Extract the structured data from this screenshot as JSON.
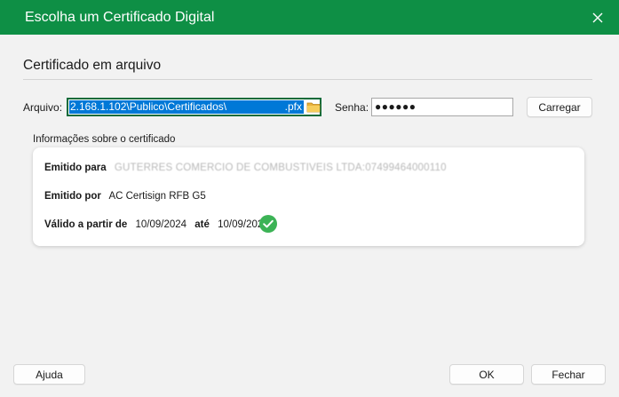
{
  "window": {
    "title": "Escolha um Certificado Digital",
    "accent_color": "#0e8f45"
  },
  "section": {
    "title": "Certificado em arquivo"
  },
  "file": {
    "label": "Arquivo:",
    "path": "2.168.1.102\\Publico\\Certificados\\",
    "extension": ".pfx",
    "folder_icon": "folder-icon"
  },
  "password": {
    "label": "Senha:",
    "masked_value": "●●●●●●"
  },
  "buttons": {
    "load": "Carregar",
    "help": "Ajuda",
    "ok": "OK",
    "close": "Fechar"
  },
  "info": {
    "title": "Informações sobre o certificado",
    "issued_to_label": "Emitido para",
    "issued_to_value": "GUTERRES COMERCIO DE COMBUSTIVEIS LTDA:07499464000110",
    "issued_by_label": "Emitido por",
    "issued_by_value": "AC Certisign RFB G5",
    "valid_from_label": "Válido a partir de",
    "valid_from": "10/09/2024",
    "until_label": "até",
    "valid_to": "10/09/2025",
    "status_icon": "check-circle-icon",
    "status_color": "#3cb356"
  }
}
